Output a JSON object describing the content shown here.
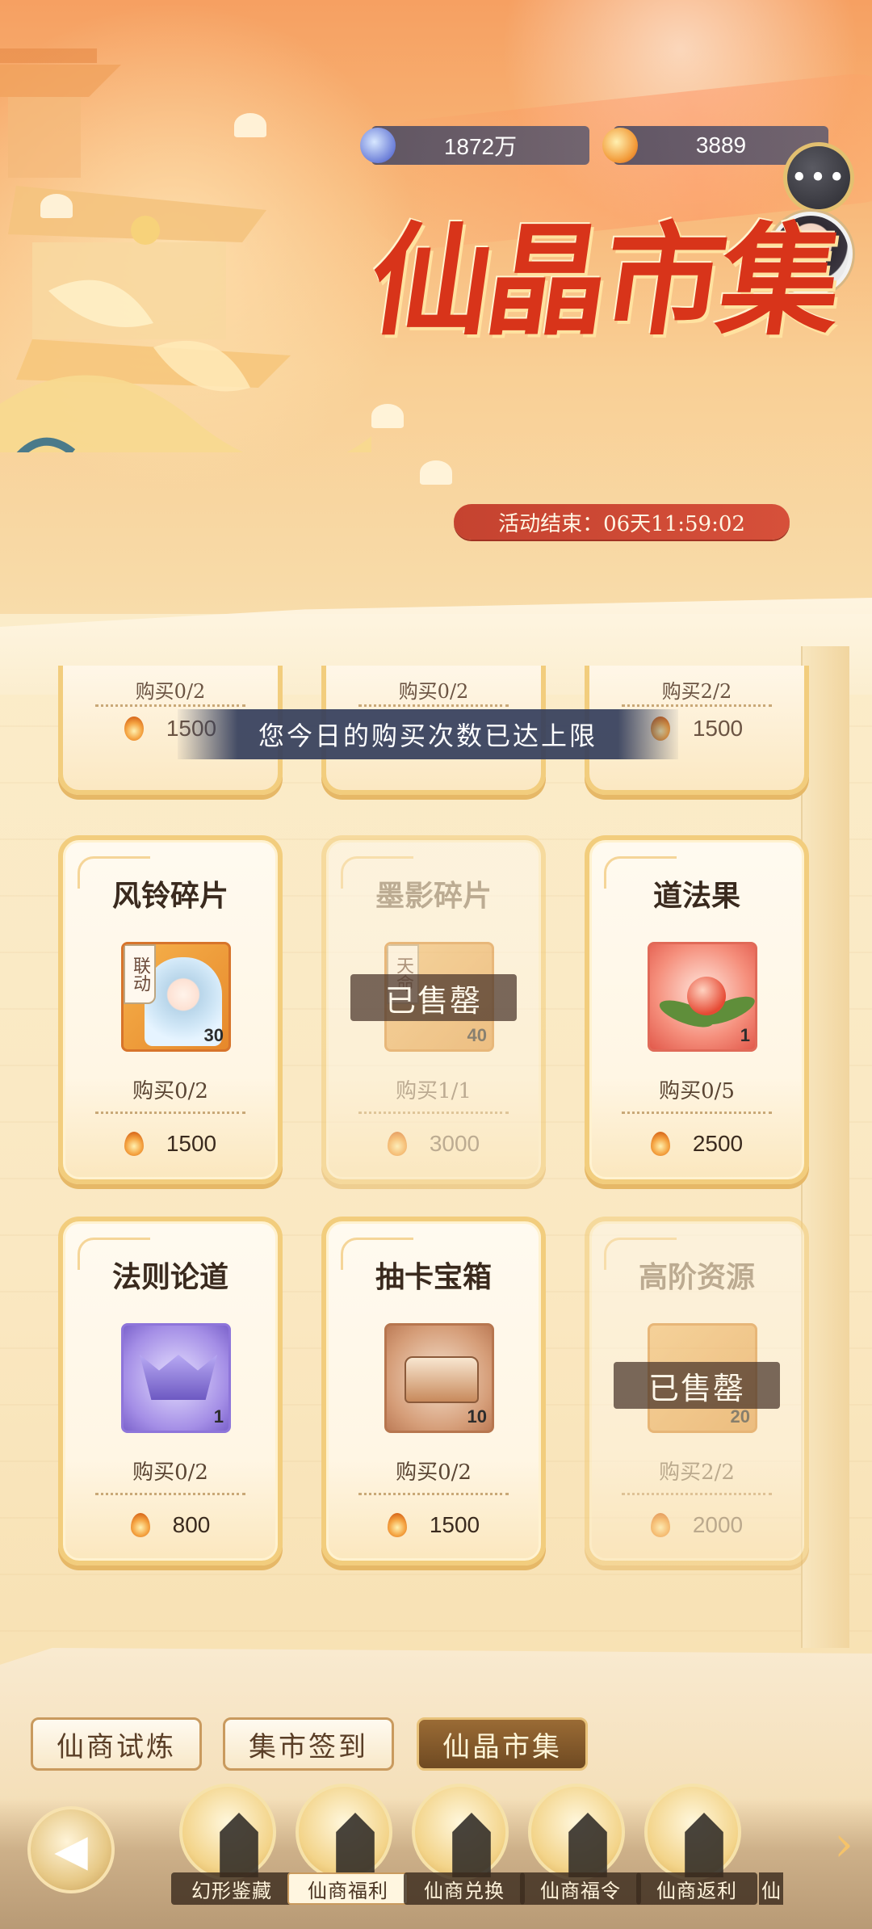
{
  "currencies": [
    {
      "icon": "crystal-currency-icon",
      "value": "1872万"
    },
    {
      "icon": "flame-currency-icon",
      "value": "3889"
    }
  ],
  "header": {
    "title": "仙晶市集",
    "timer_label": "活动结束：06天11:59:02"
  },
  "toast": "您今日的购买次数已达上限",
  "partial_row": [
    {
      "limit": "购买0/2",
      "price": "1500"
    },
    {
      "limit": "购买0/2",
      "price": ""
    },
    {
      "limit": "购买2/2",
      "price": "1500"
    }
  ],
  "items": [
    {
      "name": "风铃碎片",
      "qty": "30",
      "limit": "购买0/2",
      "price": "1500",
      "tag": "联动",
      "sold_out": false
    },
    {
      "name": "墨影碎片",
      "qty": "40",
      "limit": "购买1/1",
      "price": "3000",
      "tag": "天命",
      "sold_out": true,
      "sold_label": "已售罄"
    },
    {
      "name": "道法果",
      "qty": "1",
      "limit": "购买0/5",
      "price": "2500",
      "sold_out": false
    },
    {
      "name": "法则论道",
      "qty": "1",
      "limit": "购买0/2",
      "price": "800",
      "sold_out": false
    },
    {
      "name": "抽卡宝箱",
      "qty": "10",
      "limit": "购买0/2",
      "price": "1500",
      "sold_out": false
    },
    {
      "name": "高阶资源",
      "qty": "20",
      "limit": "购买2/2",
      "price": "2000",
      "sold_out": true,
      "sold_label": "已售罄"
    }
  ],
  "tabs": [
    {
      "label": "仙商试炼",
      "active": false
    },
    {
      "label": "集市签到",
      "active": false
    },
    {
      "label": "仙晶市集",
      "active": true
    }
  ],
  "nav": [
    {
      "label": "幻形鉴藏",
      "icon": "collection-icon"
    },
    {
      "label": "仙商福利",
      "icon": "welfare-icon",
      "active": true
    },
    {
      "label": "仙商兑换",
      "icon": "exchange-icon"
    },
    {
      "label": "仙商福令",
      "icon": "token-icon"
    },
    {
      "label": "仙商返利",
      "icon": "rebate-icon"
    },
    {
      "label": "仙",
      "icon": "more-icon"
    }
  ],
  "colors": {
    "accent_red": "#d8341a",
    "card_border": "#f2cd7d",
    "active_tab": "#6f4a22"
  }
}
